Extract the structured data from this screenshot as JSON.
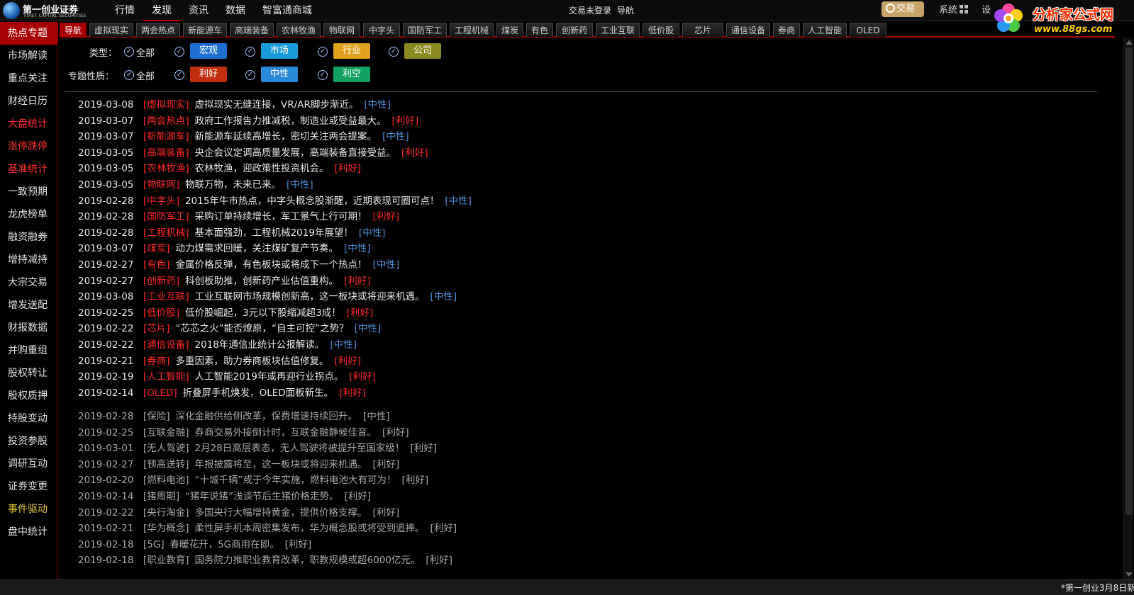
{
  "app": {
    "logo_name": "第一创业证券",
    "logo_sub": "FIRST CAPITAL SECURITIES"
  },
  "topnav": [
    "行情",
    "发现",
    "资讯",
    "数据",
    "智富通商城"
  ],
  "topbar": {
    "login": "交易未登录",
    "nav": "导航",
    "trade": "交易",
    "system": "系统",
    "settings": "设"
  },
  "watermark": {
    "title": "分析家公式网",
    "url": "www.88gs.com"
  },
  "sidebar": [
    "热点专题",
    "市场解读",
    "重点关注",
    "财经日历",
    "大盘统计",
    "涨停跌停",
    "基准统计",
    "一致预期",
    "龙虎榜单",
    "融资融券",
    "增持减持",
    "大宗交易",
    "增发送配",
    "财报数据",
    "并购重组",
    "股权转让",
    "股权质押",
    "持股变动",
    "投资参股",
    "调研互动",
    "证券变更",
    "事件驱动",
    "盘中统计"
  ],
  "tabs": [
    "导航",
    "虚拟现实",
    "两会热点",
    "新能源车",
    "高端装备",
    "农林牧渔",
    "物联网",
    "中字头",
    "国防军工",
    "工程机械",
    "煤炭",
    "有色",
    "创新药",
    "工业互联",
    "低价股",
    "芯片",
    "通信设备",
    "券商",
    "人工智能",
    "OLED"
  ],
  "filters": {
    "type_label": "类型：",
    "nature_label": "专题性质：",
    "all": "全部",
    "type_pills": [
      {
        "label": "宏观",
        "color": "#1e6fd0"
      },
      {
        "label": "市场",
        "color": "#1a9ad8"
      },
      {
        "label": "行业",
        "color": "#e0a020"
      },
      {
        "label": "公司",
        "color": "#8a8a20"
      }
    ],
    "nature_pills": [
      {
        "label": "利好",
        "color": "#c03010"
      },
      {
        "label": "中性",
        "color": "#2a88d8"
      },
      {
        "label": "利空",
        "color": "#10a060"
      }
    ]
  },
  "news_highlight": [
    {
      "date": "2019-03-08",
      "cat": "[虚拟现实]",
      "title": "虚拟现实无缝连接，VR/AR脚步渐近。",
      "tag": "[中性]"
    },
    {
      "date": "2019-03-07",
      "cat": "[两会热点]",
      "title": "政府工作报告力推减税，制造业或受益最大。",
      "tag": "[利好]"
    },
    {
      "date": "2019-03-07",
      "cat": "[新能源车]",
      "title": "新能源车延续高增长，密切关注两会提案。",
      "tag": "[中性]"
    },
    {
      "date": "2019-03-05",
      "cat": "[高端装备]",
      "title": "央企会议定调高质量发展，高端装备直接受益。",
      "tag": "[利好]"
    },
    {
      "date": "2019-03-05",
      "cat": "[农林牧渔]",
      "title": "农林牧渔，迎政策性投资机会。",
      "tag": "[利好]"
    },
    {
      "date": "2019-03-05",
      "cat": "[物联网]",
      "title": "物联万物，未来已来。",
      "tag": "[中性]"
    },
    {
      "date": "2019-02-28",
      "cat": "[中字头]",
      "title": "2015年牛市热点，中字头概念股渐醒，近期表现可圈可点！",
      "tag": "[中性]"
    },
    {
      "date": "2019-02-28",
      "cat": "[国防军工]",
      "title": "采购订单持续增长，军工景气上行可期！",
      "tag": "[利好]"
    },
    {
      "date": "2019-02-28",
      "cat": "[工程机械]",
      "title": "基本面强劲，工程机械2019年展望！",
      "tag": "[中性]"
    },
    {
      "date": "2019-03-07",
      "cat": "[煤炭]",
      "title": "动力煤需求回暖，关注煤矿复产节奏。",
      "tag": "[中性]"
    },
    {
      "date": "2019-02-27",
      "cat": "[有色]",
      "title": "金属价格反弹，有色板块或将成下一个热点！",
      "tag": "[中性]"
    },
    {
      "date": "2019-02-27",
      "cat": "[创新药]",
      "title": "科创板助推，创新药产业估值重构。",
      "tag": "[利好]"
    },
    {
      "date": "2019-03-08",
      "cat": "[工业互联]",
      "title": "工业互联网市场规模创新高，这一板块或将迎来机遇。",
      "tag": "[中性]"
    },
    {
      "date": "2019-02-25",
      "cat": "[低价股]",
      "title": "低价股崛起，3元以下股缩减超3成！",
      "tag": "[利好]"
    },
    {
      "date": "2019-02-22",
      "cat": "[芯片]",
      "title": "“芯芯之火”能否燎原，“自主可控”之势？",
      "tag": "[中性]"
    },
    {
      "date": "2019-02-22",
      "cat": "[通信设备]",
      "title": "2018年通信业统计公报解读。",
      "tag": "[中性]"
    },
    {
      "date": "2019-02-21",
      "cat": "[券商]",
      "title": "多重因素，助力券商板块估值修复。",
      "tag": "[利好]"
    },
    {
      "date": "2019-02-19",
      "cat": "[人工智能]",
      "title": "人工智能2019年或再迎行业拐点。",
      "tag": "[利好]"
    },
    {
      "date": "2019-02-14",
      "cat": "[OLED]",
      "title": "折叠屏手机焕发，OLED面板新生。",
      "tag": "[利好]"
    }
  ],
  "news_other": [
    {
      "date": "2019-02-28",
      "cat": "[保险]",
      "title": "深化金融供给侧改革，保费增速持续回升。",
      "tag": "[中性]"
    },
    {
      "date": "2019-02-25",
      "cat": "[互联金融]",
      "title": "券商交易外接倒计时，互联金融静候佳音。",
      "tag": "[利好]"
    },
    {
      "date": "2019-03-01",
      "cat": "[无人驾驶]",
      "title": "2月28日高层表态，无人驾驶将被提升至国家级！",
      "tag": "[利好]"
    },
    {
      "date": "2019-02-27",
      "cat": "[预高送转]",
      "title": "年报披露将至，这一板块或将迎来机遇。",
      "tag": "[利好]"
    },
    {
      "date": "2019-02-20",
      "cat": "[燃料电池]",
      "title": "“十城千辆”或于今年实施，燃料电池大有可为！",
      "tag": "[利好]"
    },
    {
      "date": "2019-02-14",
      "cat": "[猪周期]",
      "title": "“猪年说猪”浅谈节后生猪价格走势。",
      "tag": "[利好]"
    },
    {
      "date": "2019-02-22",
      "cat": "[央行淘金]",
      "title": "多国央行大幅增持黄金，提供价格支撑。",
      "tag": "[利好]"
    },
    {
      "date": "2019-02-21",
      "cat": "[华为概念]",
      "title": "柔性屏手机本周密集发布，华为概念股或将受到追捧。",
      "tag": "[利好]"
    },
    {
      "date": "2019-02-18",
      "cat": "[5G]",
      "title": "春暖花开，5G商用在即。",
      "tag": "[利好]"
    },
    {
      "date": "2019-02-18",
      "cat": "[职业教育]",
      "title": "国务院力推职业教育改革，职教规模或超6000亿元。",
      "tag": "[利好]"
    }
  ],
  "status": {
    "ticker": "*第一创业3月8日新"
  }
}
